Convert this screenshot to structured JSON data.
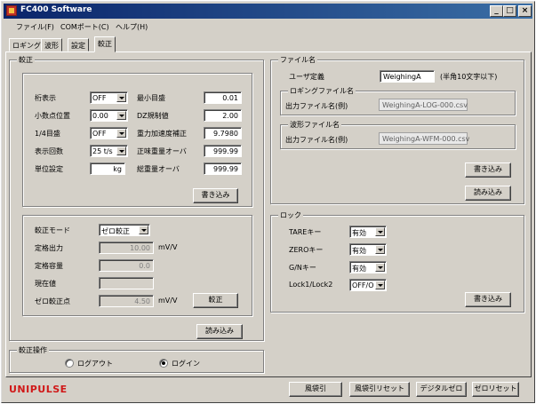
{
  "window": {
    "title": "FC400 Software"
  },
  "menu": [
    "ファイル(F)",
    "COMポート(C)",
    "ヘルプ(H)"
  ],
  "tabs": [
    "ロギング",
    "波形",
    "設定",
    "較正"
  ],
  "calibration": {
    "title": "較正",
    "settings": {
      "rows_left": [
        {
          "label": "桁表示",
          "value": "OFF"
        },
        {
          "label": "小数点位置",
          "value": "0.00"
        },
        {
          "label": "1/4目盛",
          "value": "OFF"
        },
        {
          "label": "表示回数",
          "value": "25 t/s"
        },
        {
          "label": "単位設定",
          "value": "kg"
        }
      ],
      "rows_right": [
        {
          "label": "最小目盛",
          "value": "0.01"
        },
        {
          "label": "DZ規制値",
          "value": "2.00"
        },
        {
          "label": "重力加速度補正",
          "value": "9.7980"
        },
        {
          "label": "正味重量オーバ",
          "value": "999.99"
        },
        {
          "label": "総重量オーバ",
          "value": "999.99"
        }
      ],
      "write_button": "書き込み"
    },
    "mode": {
      "mode_label": "較正モード",
      "mode_value": "ゼロ較正",
      "rated_output_label": "定格出力",
      "rated_output_value": "10.00",
      "rated_output_unit": "mV/V",
      "rated_capacity_label": "定格容量",
      "rated_capacity_value": "0.0",
      "current_value_label": "現在値",
      "current_value_value": "",
      "zero_point_label": "ゼロ較正点",
      "zero_point_value": "4.50",
      "zero_point_unit": "mV/V",
      "calibrate_button": "較正"
    },
    "read_button": "読み込み"
  },
  "operation": {
    "title": "較正操作",
    "logout_label": "ログアウト",
    "login_label": "ログイン",
    "selected": "login"
  },
  "filename": {
    "title": "ファイル名",
    "user_def_label": "ユーザ定義",
    "user_def_value": "WeighingA",
    "user_def_hint": "(半角10文字以下)",
    "logging_group": "ロギングファイル名",
    "logging_label": "出力ファイル名(例)",
    "logging_value": "WeighingA-LOG-000.csv",
    "waveform_group": "波形ファイル名",
    "waveform_label": "出力ファイル名(例)",
    "waveform_value": "WeighingA-WFM-000.csv",
    "write_button": "書き込み",
    "read_button": "読み込み"
  },
  "lock": {
    "title": "ロック",
    "rows": [
      {
        "label": "TAREキー",
        "value": "有効"
      },
      {
        "label": "ZEROキー",
        "value": "有効"
      },
      {
        "label": "G/Nキー",
        "value": "有効"
      },
      {
        "label": "Lock1/Lock2",
        "value": "OFF/O"
      }
    ],
    "write_button": "書き込み"
  },
  "footer": {
    "logo": "UNIPULSE",
    "buttons": [
      "風袋引",
      "風袋引リセット",
      "デジタルゼロ",
      "ゼロリセット"
    ]
  }
}
